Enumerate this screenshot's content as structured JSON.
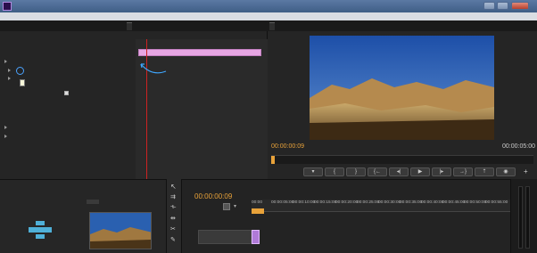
{
  "app": {
    "title": "",
    "icon": "premiere-logo-icon"
  },
  "menu": [
    "",
    "",
    "",
    "",
    "",
    "",
    "",
    "",
    ""
  ],
  "tabs": {
    "source": "",
    "effect_controls": "",
    "audio_mixer": "",
    "metadata": "",
    "program": ""
  },
  "effect_controls": {
    "header": "",
    "clip_label": "",
    "clip_bar": "",
    "section": "",
    "motion": "",
    "position_label": "",
    "position_x": "",
    "position_y": "",
    "scale_label": "",
    "scale_value": "",
    "scale_width_label": "",
    "scale_width_value": "",
    "uniform_scale": "",
    "rotation_label": "",
    "rotation_value": "",
    "anchor_label": "",
    "anchor_x": "",
    "anchor_y": "",
    "flicker_label": "",
    "flicker_value": "",
    "opacity": "",
    "time_remap": "",
    "tooltip": ""
  },
  "program": {
    "timecode_current": "00:00:00:09",
    "timecode_duration": "00:00:05:00",
    "fit": "",
    "quality": ""
  },
  "project": {
    "tabs": [
      "",
      "",
      "",
      "",
      "",
      ""
    ],
    "project_name": "",
    "count": "",
    "entry_label": "",
    "entry_value": ""
  },
  "sequence": {
    "tab": "",
    "timecode": "00:00:00:09",
    "ruler": [
      "00:00",
      "00:00:05:00",
      "00:00:10:00",
      "00:00:15:00",
      "00:00:20:00",
      "00:00:25:00",
      "00:00:30:00",
      "00:00:35:00",
      "00:00:40:00",
      "00:00:45:00",
      "00:00:50:00",
      "00:00:55:00",
      "00:01:00:00"
    ],
    "tracks": [
      "",
      "",
      ""
    ]
  },
  "colors": {
    "accent_value": "#e8a23a",
    "clip_pink": "#e7a6e3",
    "playhead": "#cc2222"
  }
}
